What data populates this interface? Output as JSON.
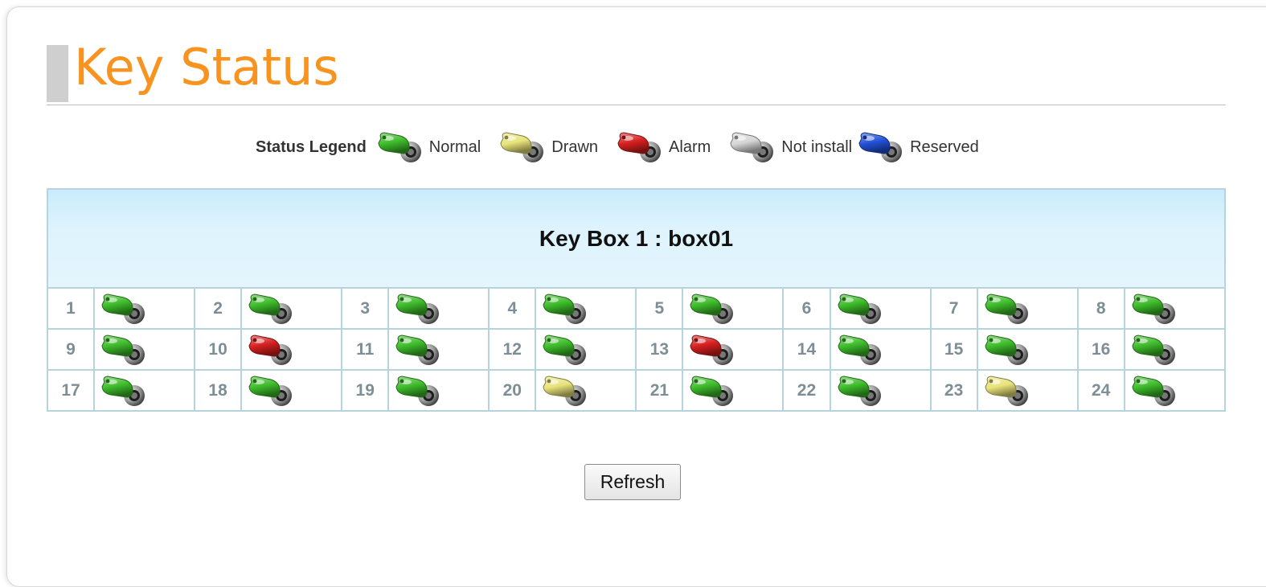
{
  "page": {
    "title": "Key Status"
  },
  "legend": {
    "title": "Status Legend",
    "items": [
      {
        "status": "normal",
        "label": "Normal",
        "color": "#3dbb2a",
        "icon": "key-icon"
      },
      {
        "status": "drawn",
        "label": "Drawn",
        "color": "#e8e37a",
        "icon": "key-icon"
      },
      {
        "status": "alarm",
        "label": "Alarm",
        "color": "#d61f1f",
        "icon": "key-icon"
      },
      {
        "status": "not_install",
        "label": "Not install",
        "color": "#d6d6d6",
        "icon": "key-icon"
      },
      {
        "status": "reserved",
        "label": "Reserved",
        "color": "#2250d8",
        "icon": "key-icon"
      }
    ]
  },
  "keybox": {
    "title": "Key Box 1 : box01",
    "slots": [
      {
        "num": "1",
        "status": "normal"
      },
      {
        "num": "2",
        "status": "normal"
      },
      {
        "num": "3",
        "status": "normal"
      },
      {
        "num": "4",
        "status": "normal"
      },
      {
        "num": "5",
        "status": "normal"
      },
      {
        "num": "6",
        "status": "normal"
      },
      {
        "num": "7",
        "status": "normal"
      },
      {
        "num": "8",
        "status": "normal"
      },
      {
        "num": "9",
        "status": "normal"
      },
      {
        "num": "10",
        "status": "alarm"
      },
      {
        "num": "11",
        "status": "normal"
      },
      {
        "num": "12",
        "status": "normal"
      },
      {
        "num": "13",
        "status": "alarm"
      },
      {
        "num": "14",
        "status": "normal"
      },
      {
        "num": "15",
        "status": "normal"
      },
      {
        "num": "16",
        "status": "normal"
      },
      {
        "num": "17",
        "status": "normal"
      },
      {
        "num": "18",
        "status": "normal"
      },
      {
        "num": "19",
        "status": "normal"
      },
      {
        "num": "20",
        "status": "drawn"
      },
      {
        "num": "21",
        "status": "normal"
      },
      {
        "num": "22",
        "status": "normal"
      },
      {
        "num": "23",
        "status": "drawn"
      },
      {
        "num": "24",
        "status": "normal"
      }
    ]
  },
  "actions": {
    "refresh_label": "Refresh"
  }
}
